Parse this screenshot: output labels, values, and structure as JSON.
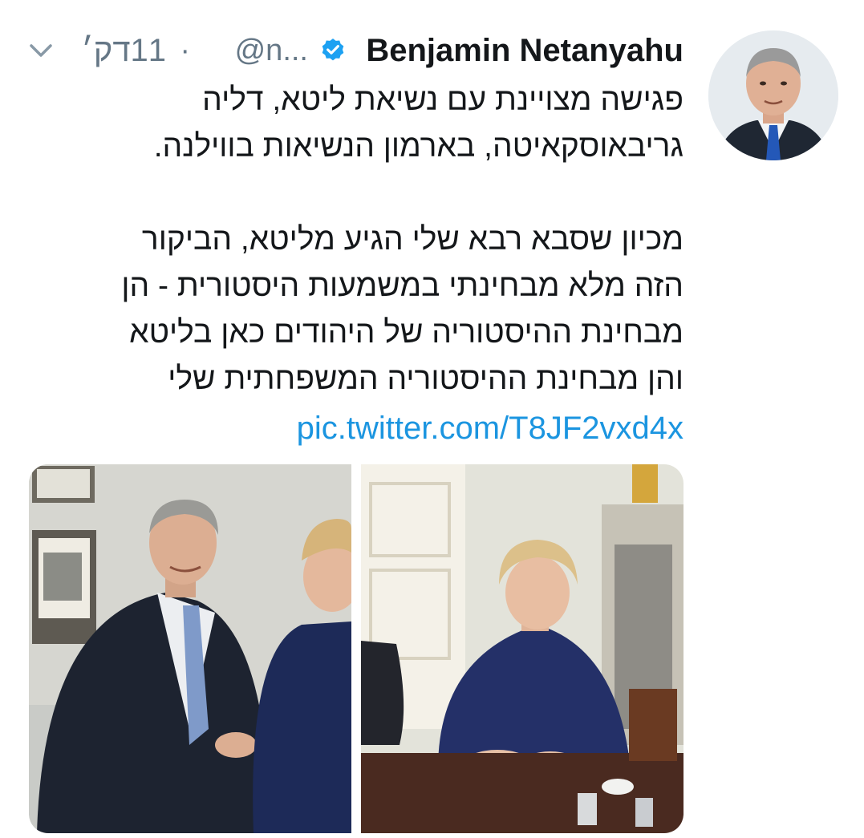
{
  "tweet": {
    "author_name": "Benjamin Netanyahu",
    "handle": "@n...",
    "separator": "·",
    "time": "11דק׳",
    "text_lines": [
      "פגישה מצויינת עם נשיאת ליטא, דליה",
      "גריבאוסקאיטה, בארמון הנשיאות בווילנה.",
      "",
      "מכיון שסבא רבא שלי הגיע מליטא, הביקור",
      "הזה מלא מבחינתי במשמעות היסטורית - הן",
      "מבחינת ההיסטוריה של היהודים כאן בליטא",
      "והן מבחינת ההיסטוריה המשפחתית שלי"
    ],
    "link": "pic.twitter.com/T8JF2vxd4x"
  },
  "icons": {
    "verified": "verified-badge-icon",
    "chevron": "chevron-down-icon"
  },
  "colors": {
    "verified_blue": "#1da1f2",
    "link_blue": "#1b95e0",
    "secondary_text": "#657786",
    "primary_text": "#14171a"
  }
}
